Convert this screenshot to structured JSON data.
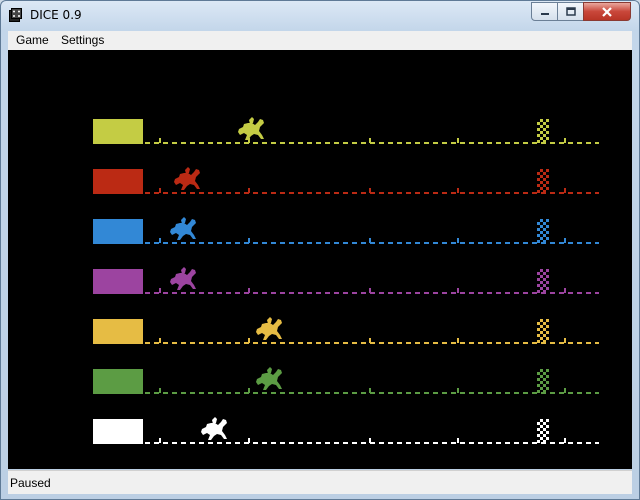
{
  "window": {
    "title": "DICE 0.9",
    "icon": "dice-icon"
  },
  "menu": {
    "items": [
      "Game",
      "Settings"
    ]
  },
  "controls": {
    "minimize": "minimize-icon",
    "maximize": "maximize-icon",
    "close": "close-icon"
  },
  "race": {
    "lanes": [
      {
        "color": "#c4cc44",
        "horse_position": 0.2
      },
      {
        "color": "#bb2a14",
        "horse_position": 0.06
      },
      {
        "color": "#3288d6",
        "horse_position": 0.05
      },
      {
        "color": "#9c44a0",
        "horse_position": 0.05
      },
      {
        "color": "#e6bc44",
        "horse_position": 0.24
      },
      {
        "color": "#5c9c44",
        "horse_position": 0.24
      },
      {
        "color": "#ffffff",
        "horse_position": 0.12
      }
    ]
  },
  "status": {
    "text": "Paused"
  }
}
